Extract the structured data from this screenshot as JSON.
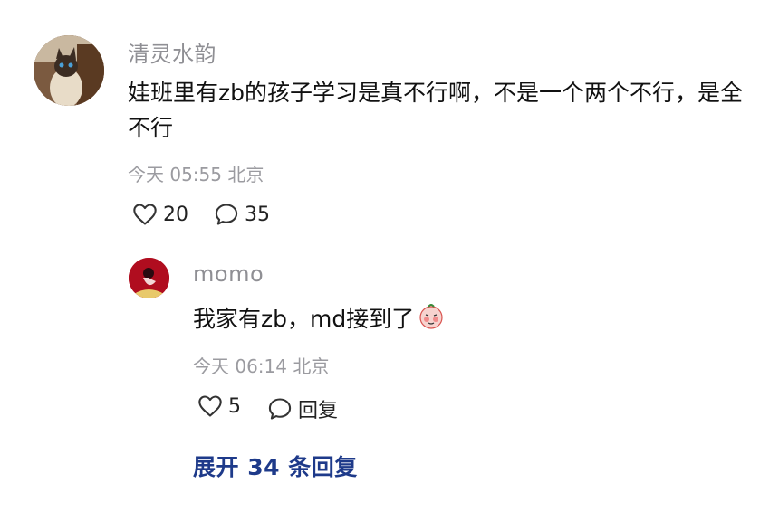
{
  "comment": {
    "username": "清灵水韵",
    "text": "娃班里有zb的孩子学习是真不行啊，不是一个两个不行，是全不行",
    "meta": "今天 05:55 北京",
    "likes": "20",
    "replies": "35"
  },
  "reply": {
    "username": "momo",
    "text": "我家有zb，md接到了",
    "emoji_icon": "blushing-face-sticker",
    "meta": "今天 06:14 北京",
    "likes": "5",
    "reply_label": "回复"
  },
  "expand_label": "展开 34 条回复",
  "colors": {
    "link": "#1e3a8a",
    "muted": "#9b9ba0",
    "text": "#111111"
  }
}
